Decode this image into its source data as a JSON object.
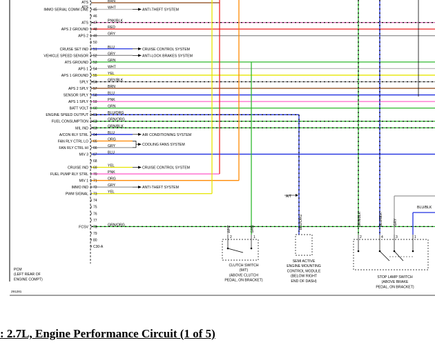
{
  "pins": [
    {
      "pin": "",
      "func": "",
      "color": "BRN",
      "wire": "#8b4513",
      "to": "red"
    },
    {
      "pin": "45",
      "func": "IMMO SERIAL COMM LINE",
      "color": "WHT",
      "wire": "#bbbbbb",
      "bracket": "ats"
    },
    {
      "pin": "46",
      "func": "",
      "color": "",
      "wire": ""
    },
    {
      "pin": "47",
      "func": "ATS",
      "color": "PNK/BLK",
      "wire": "#d86bb0",
      "dash": true
    },
    {
      "pin": "48",
      "func": "APS 2 GROUND",
      "color": "RED",
      "wire": "#ee2222"
    },
    {
      "pin": "49",
      "func": "APS 2",
      "color": "GRY",
      "wire": "#999999"
    },
    {
      "pin": "50",
      "func": "",
      "color": "",
      "wire": ""
    },
    {
      "pin": "51",
      "func": "CRUISE SET IND",
      "color": "BLU",
      "wire": "#1f2fe0",
      "bracket": "ccs"
    },
    {
      "pin": "52",
      "func": "VEHICLE SPEED SENSOR",
      "color": "GRY",
      "wire": "#999999",
      "bracket": "abs"
    },
    {
      "pin": "53",
      "func": "ATS GROUND",
      "color": "GRN",
      "wire": "#2eb82e"
    },
    {
      "pin": "54",
      "func": "APS 1",
      "color": "WHT",
      "wire": "#bbbbbb"
    },
    {
      "pin": "55",
      "func": "APS 1 GROUND",
      "color": "YEL",
      "wire": "#e6e600"
    },
    {
      "pin": "56",
      "func": "SPLY",
      "color": "GRY/BLK",
      "wire": "#999999",
      "dash": true
    },
    {
      "pin": "57",
      "func": "APS 2 SPLY",
      "color": "BRN",
      "wire": "#8b4513"
    },
    {
      "pin": "58",
      "func": "SENSOR SPLY",
      "color": "BLU",
      "wire": "#1f2fe0"
    },
    {
      "pin": "59",
      "func": "APS 1 SPLY",
      "color": "PNK",
      "wire": "#ff66cc"
    },
    {
      "pin": "60",
      "func": "BATT VOLT",
      "color": "GRN",
      "wire": "#2eb82e"
    },
    {
      "pin": "61",
      "func": "ENGINE SPEED OUTPUT",
      "color": "BLU/ORG",
      "wire": "#1f2fe0",
      "dash": true,
      "to": "ams"
    },
    {
      "pin": "62",
      "func": "FUEL CONSUMPTION",
      "color": "GRN/ORG",
      "wire": "#2eb82e",
      "dash": true
    },
    {
      "pin": "63",
      "func": "MIL IND",
      "color": "GRN/BLK",
      "wire": "#2eb82e",
      "dash": true
    },
    {
      "pin": "64",
      "func": "A/CON RLY STRL",
      "color": "BLU",
      "wire": "#1f2fe0",
      "bracket": "acs"
    },
    {
      "pin": "65",
      "func": "FAN RLY CTRL LO",
      "color": "ORG",
      "wire": "#ff8800",
      "bracket": "cfs"
    },
    {
      "pin": "66",
      "func": "FAN RLY CTRL HI",
      "color": "GRY",
      "wire": "#999999",
      "bracket": "cfs"
    },
    {
      "pin": "67",
      "func": "MIV 3",
      "color": "BLU",
      "wire": "#1f2fe0"
    },
    {
      "pin": "68",
      "func": "",
      "color": "",
      "wire": ""
    },
    {
      "pin": "69",
      "func": "CRUISE IND",
      "color": "YEL",
      "wire": "#e6e600",
      "bracket": "ccs2"
    },
    {
      "pin": "70",
      "func": "FUEL PUMP RLY STRL",
      "color": "PNK",
      "wire": "#ff66cc",
      "to": "red"
    },
    {
      "pin": "71",
      "func": "MIV 1",
      "color": "ORG",
      "wire": "#ff8800",
      "to": "org"
    },
    {
      "pin": "72",
      "func": "IMMO IND",
      "color": "GRY",
      "wire": "#999999",
      "bracket": "ats2"
    },
    {
      "pin": "73",
      "func": "PWM SIGNAL",
      "color": "YEL",
      "wire": "#e6e600",
      "to": "yel"
    },
    {
      "pin": "74",
      "func": "",
      "color": "",
      "wire": ""
    },
    {
      "pin": "75",
      "func": "",
      "color": "",
      "wire": ""
    },
    {
      "pin": "76",
      "func": "",
      "color": "",
      "wire": ""
    },
    {
      "pin": "77",
      "func": "",
      "color": "",
      "wire": ""
    },
    {
      "pin": "78",
      "func": "FCSV",
      "color": "GRN/ORG",
      "wire": "#2eb82e",
      "dash": true
    },
    {
      "pin": "79",
      "func": "",
      "color": "",
      "wire": ""
    },
    {
      "pin": "80",
      "func": "",
      "color": "",
      "wire": ""
    },
    {
      "pin": "C30-A",
      "func": "",
      "color": "",
      "wire": ""
    }
  ],
  "top_labels": [
    "ATS",
    "ATS"
  ],
  "systems": {
    "ats": "ANTI-THEFT SYSTEM",
    "ccs": "CRUISE CONTROL SYSTEM",
    "abs": "ANTI-LOCK BRAKES SYSTEM",
    "acs": "AIR CONDITIONING SYSTEM",
    "cfs": "COOLING FANS SYSTEM",
    "ccs2": "CRUISE CONTROL SYSTEM",
    "ats2": "ANTI-THEFT SYSTEM"
  },
  "pcm_label": [
    "PCM",
    "(LEFT REAR OF",
    "ENGINE COMPT)"
  ],
  "at_label": "A/T",
  "components": {
    "clutch": {
      "label": [
        "CLUTCH SWITCH",
        "(M/T)",
        "(ABOVE CLUTCH",
        "PEDAL, ON BRACKET)"
      ],
      "wires": [
        "WHT",
        "GRN"
      ],
      "pins": [
        "2",
        "1"
      ]
    },
    "mount": {
      "label": [
        "SEMI ACTIVE",
        "ENGINE MOUNTING",
        "CONTROL MODULE",
        "(BELOW RIGHT",
        "END OF DASH)"
      ],
      "wires": [
        "BLU/ORG"
      ]
    },
    "stoplamp": {
      "label": [
        "STOP LAMP SWITCH",
        "(ABOVE BRAKE",
        "PEDAL, ON BRACKET)"
      ],
      "wires": [
        "GRN/BLK",
        "BLU/BLK",
        "GRY"
      ],
      "pins": [
        "2",
        "4",
        "3",
        "1"
      ]
    },
    "blublk_right": "BLU/BLK"
  },
  "figure_id": "291281",
  "caption": ": 2.7L, Engine Performance Circuit (1 of 5)"
}
